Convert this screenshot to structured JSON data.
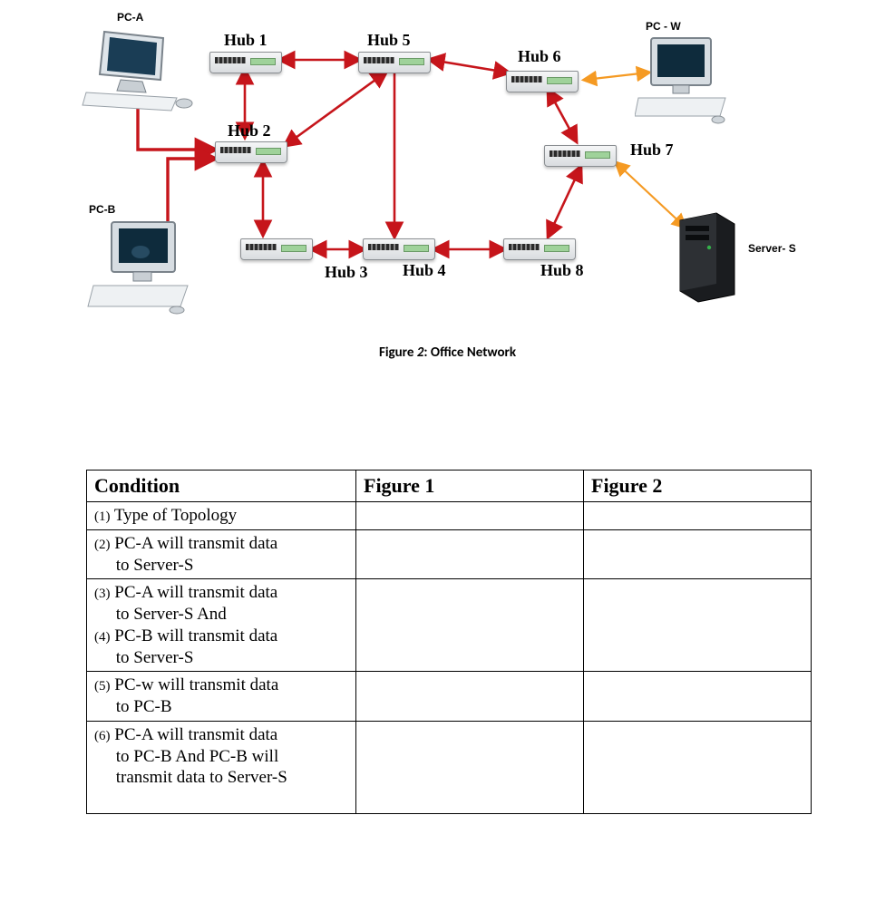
{
  "diagram": {
    "pc_a": "PC-A",
    "pc_b": "PC-B",
    "pc_w": "PC - W",
    "server_s": "Server- S",
    "hub1": "Hub 1",
    "hub2": "Hub 2",
    "hub3": "Hub 3",
    "hub4": "Hub 4",
    "hub5": "Hub 5",
    "hub6": "Hub 6",
    "hub7": "Hub 7",
    "hub8": "Hub 8"
  },
  "caption": "Figure 2: Office Network",
  "table": {
    "headers": {
      "c0": "Condition",
      "c1": "Figure 1",
      "c2": "Figure 2"
    },
    "rows": {
      "r1": "(1) Type of Topology",
      "r2": "(2) PC-A will transmit data to Server-S",
      "r3": "(3) PC-A will transmit data to Server-S And",
      "r4": "(4) PC-B will transmit data to Server-S",
      "r5": "(5) PC-w will transmit data to PC-B",
      "r6": "(6) PC-A will transmit data to PC-B And PC-B will transmit data to Server-S"
    }
  }
}
